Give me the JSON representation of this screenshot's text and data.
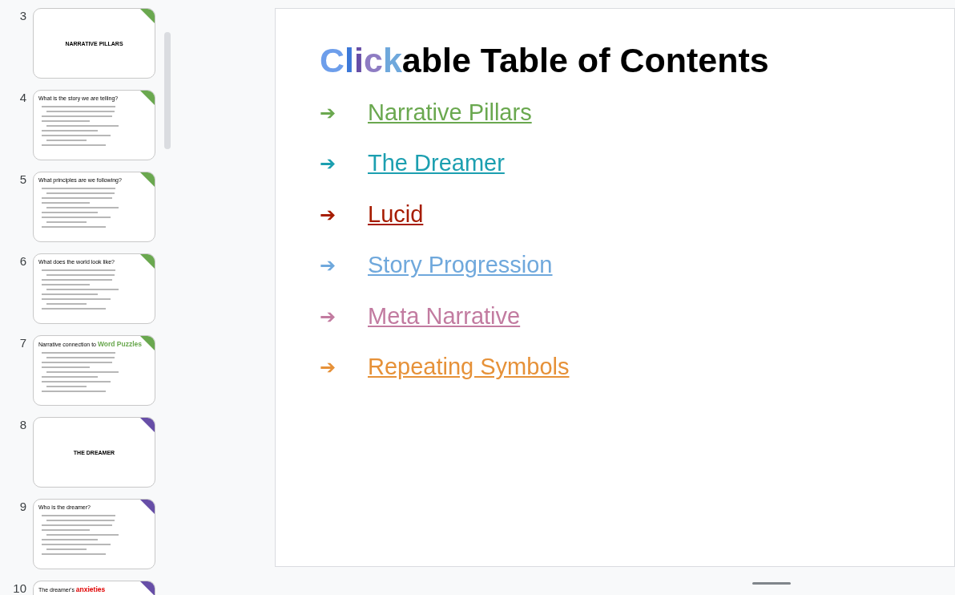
{
  "thumbnails": [
    {
      "number": "3",
      "kind": "section",
      "color": "#6aa84f",
      "title": [
        {
          "text": "NARRATIVE PILLARS"
        }
      ]
    },
    {
      "number": "4",
      "kind": "content",
      "color": "#6aa84f",
      "title": [
        {
          "text": "What is the story we are telling?"
        }
      ]
    },
    {
      "number": "5",
      "kind": "content",
      "color": "#6aa84f",
      "title": [
        {
          "text": "What principles are we following?"
        }
      ]
    },
    {
      "number": "6",
      "kind": "content",
      "color": "#6aa84f",
      "title": [
        {
          "text": "What does the world look like?"
        }
      ]
    },
    {
      "number": "7",
      "kind": "content",
      "color": "#6aa84f",
      "title": [
        {
          "text": "Narrative connection to "
        },
        {
          "text": "Word Puzzles",
          "color": "#6aa84f"
        }
      ]
    },
    {
      "number": "8",
      "kind": "section",
      "color": "#674ea7",
      "title": [
        {
          "text": "THE DREAMER"
        }
      ]
    },
    {
      "number": "9",
      "kind": "content",
      "color": "#674ea7",
      "title": [
        {
          "text": "Who is the dreamer?"
        }
      ]
    },
    {
      "number": "10",
      "kind": "cut",
      "color": "#674ea7",
      "title": [
        {
          "text": "The dreamer's "
        },
        {
          "text": "anxieties",
          "color": "#e00000"
        }
      ]
    }
  ],
  "slide": {
    "title": [
      {
        "text": "C",
        "color": "#6d9eeb"
      },
      {
        "text": "l",
        "color": "#3c78d8"
      },
      {
        "text": "i",
        "color": "#674ea7"
      },
      {
        "text": "c",
        "color": "#8e7cc3"
      },
      {
        "text": "k",
        "color": "#6fa8dc"
      },
      {
        "text": "able Table of Contents",
        "color": "#000000"
      }
    ],
    "links": [
      {
        "arrow": "➔",
        "label": "Narrative Pillars",
        "color": "#6aa84f"
      },
      {
        "arrow": "➔",
        "label": "The Dreamer",
        "color": "#1c9fb0"
      },
      {
        "arrow": "➔",
        "label": "Lucid",
        "color": "#a61c00"
      },
      {
        "arrow": "➔",
        "label": "Story Progression",
        "color": "#6fa8dc"
      },
      {
        "arrow": "➔",
        "label": "Meta Narrative",
        "color": "#c27ba0"
      },
      {
        "arrow": "➔",
        "label": "Repeating Symbols",
        "color": "#e69138"
      }
    ]
  }
}
